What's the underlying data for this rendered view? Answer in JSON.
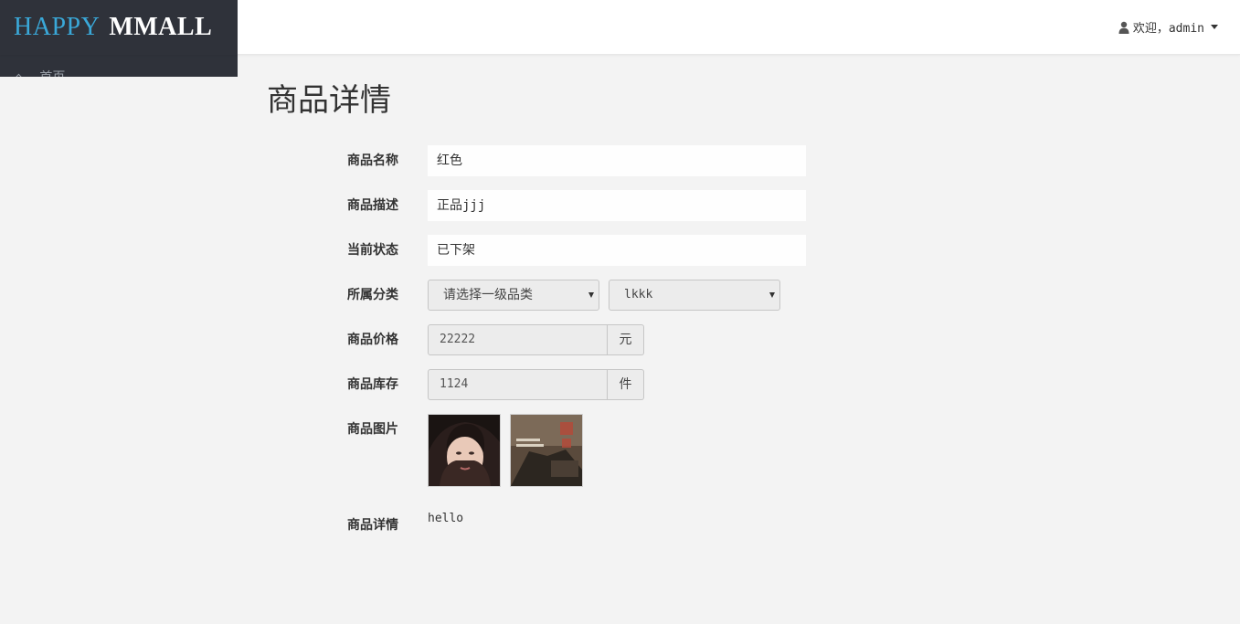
{
  "header": {
    "brand_part1": "HAPPY",
    "brand_part2": "MMALL",
    "brand_color": "#3aa8d8",
    "user_icon": "user-icon",
    "welcome_text": "欢迎，admin",
    "menu_icon": "caret-down-icon"
  },
  "sidebar": {
    "items": [
      {
        "label": "首页",
        "icon": "home-icon"
      }
    ]
  },
  "page": {
    "title": "商品详情"
  },
  "form": {
    "name": {
      "label": "商品名称",
      "value": "红色"
    },
    "subtitle": {
      "label": "商品描述",
      "value": "正品jjj"
    },
    "status": {
      "label": "当前状态",
      "value": "已下架"
    },
    "category": {
      "label": "所属分类",
      "first_level_selected": "请选择一级品类",
      "second_level_selected": "lkkk"
    },
    "price": {
      "label": "商品价格",
      "value": "22222",
      "unit": "元"
    },
    "stock": {
      "label": "商品库存",
      "value": "1124",
      "unit": "件"
    },
    "images": {
      "label": "商品图片",
      "count": 2
    },
    "detail": {
      "label": "商品详情",
      "value": "hello"
    }
  }
}
